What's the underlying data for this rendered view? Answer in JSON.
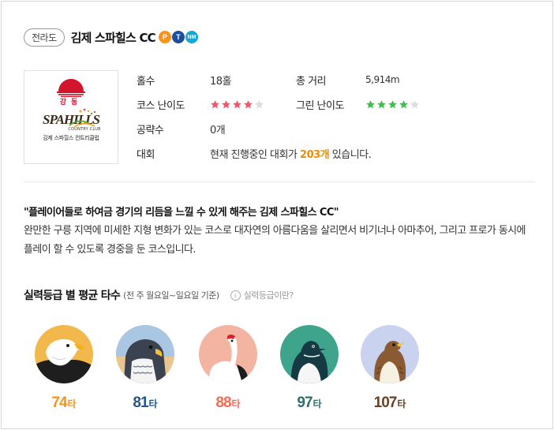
{
  "header": {
    "region": "전라도",
    "club_name": "김제 스파힐스 CC",
    "badges": [
      {
        "icon": "point-badge-icon",
        "text": "P",
        "color": "#f7941d"
      },
      {
        "icon": "tmap-badge-icon",
        "text": "T",
        "color": "#1f4e9c"
      },
      {
        "icon": "nm-badge-icon",
        "text": "NM",
        "color": "#16a6d9"
      }
    ]
  },
  "logo": {
    "korean_mark": "강동",
    "script_text": "SPAHILLS",
    "sub_text": "COUNTRY CLUB",
    "korean_name": "김제 스파힐스 컨트리클럽"
  },
  "info": {
    "holes_label": "홀수",
    "holes_value": "18홀",
    "distance_label": "총 거리",
    "distance_value": "5,914m",
    "course_difficulty_label": "코스 난이도",
    "course_difficulty_stars": 4,
    "course_difficulty_color": "#f0576a",
    "green_difficulty_label": "그린 난이도",
    "green_difficulty_stars": 4,
    "green_difficulty_color": "#3cc04a",
    "strategy_label": "공략수",
    "strategy_value": "0개",
    "tournament_label": "대회",
    "tournament_prefix": "현재 진행중인 대회가 ",
    "tournament_count": "203개",
    "tournament_suffix": " 있습니다."
  },
  "description": {
    "quote": "\"플레이어들로 하여금 경기의 리듬을 느낄 수 있게 해주는 김제 스파힐스 CC\"",
    "text": "완만한 구릉 지역에 미세한 지형 변화가 있는 코스로 대자연의 아름다움을 살리면서 비기너나 아마추어, 그리고 프로가 동시에 플레이 할 수 있도록 경중을 둔 코스입니다."
  },
  "scores_section": {
    "title": "실력등급 별 평균 타수",
    "subtitle": "(전 주 월요일~일요일 기준)",
    "help_text": "실력등급이란?",
    "grades": [
      {
        "icon": "eagle-icon",
        "value": "74",
        "unit": "타",
        "color": "#f0951b"
      },
      {
        "icon": "falcon-icon",
        "value": "81",
        "unit": "타",
        "color": "#24568e"
      },
      {
        "icon": "crane-icon",
        "value": "88",
        "unit": "타",
        "color": "#ef6e57"
      },
      {
        "icon": "penguin-icon",
        "value": "97",
        "unit": "타",
        "color": "#2f6e6e"
      },
      {
        "icon": "sparrow-icon",
        "value": "107",
        "unit": "타",
        "color": "#6b3f21"
      }
    ]
  }
}
